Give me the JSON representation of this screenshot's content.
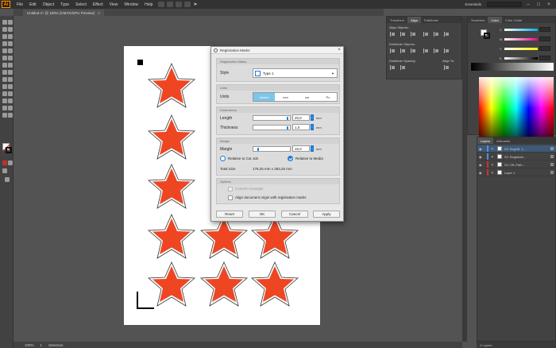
{
  "app": {
    "logo": "Ai",
    "menu": [
      "File",
      "Edit",
      "Object",
      "Type",
      "Select",
      "Effect",
      "View",
      "Window",
      "Help"
    ],
    "workspace": "Essentials",
    "search_placeholder": "Search Adobe Stock"
  },
  "document": {
    "tab_title": "Untitled-1* @ 100% (CMYK/GPU Preview)",
    "close": "×"
  },
  "status": {
    "zoom": "100%",
    "page": "1",
    "mode": "Selection"
  },
  "dialog": {
    "title": "Registration Marks",
    "close": "×",
    "sections": {
      "registration": "Registration Marks",
      "units": "Units",
      "dimensions": "Dimensions",
      "margin": "Margin",
      "options": "Options"
    },
    "style_label": "Style",
    "style_value": "Type 1",
    "units_label": "Units",
    "units_options": [
      "Inches",
      "mm",
      "cm",
      "Px"
    ],
    "units_selected": "Inches",
    "length_label": "Length",
    "length_value": "20,0",
    "length_unit": "mm",
    "thickness_label": "Thickness",
    "thickness_value": "1,0",
    "thickness_unit": "mm",
    "margin_label": "Margin",
    "margin_value": "15,0",
    "margin_unit": "mm",
    "relative_cut_label": "Relative to Cut Job",
    "relative_media_label": "Relative to Media",
    "total_size_label": "Total Size",
    "total_size_value": "178,25 mm x 283,25 mm",
    "convert_rect_label": "Convert rectangle",
    "align_origin_label": "Align document origin with registration marks",
    "buttons": {
      "reset": "Reset",
      "ok": "OK",
      "cancel": "Cancel",
      "apply": "Apply"
    }
  },
  "align_panel": {
    "tabs": [
      "Transform",
      "Align",
      "Pathfinder"
    ],
    "active_tab": "Align",
    "align_objects": "Align Objects:",
    "distribute_objects": "Distribute Objects:",
    "distribute_spacing": "Distribute Spacing:",
    "align_to": "Align To:"
  },
  "color_panel": {
    "tabs": [
      "Swatches",
      "Color",
      "Color Guide"
    ],
    "active_tab": "Color",
    "channels": [
      "C",
      "M",
      "Y",
      "K"
    ]
  },
  "layers_panel": {
    "tabs": [
      "Layers",
      "Artboards"
    ],
    "active_tab": "Layers",
    "rows": [
      {
        "name": "SC RegOff. 1...",
        "color": "#4e8fe0",
        "selected": true
      },
      {
        "name": "SC Registrati...",
        "color": "#4e8fe0",
        "selected": false
      },
      {
        "name": "SC Off.-Path...",
        "color": "#d03030",
        "selected": false
      },
      {
        "name": "Layer 1",
        "color": "#d03030",
        "selected": false
      }
    ],
    "footer": "4 Layers"
  },
  "colors": {
    "star_fill": "#ee4623",
    "accent": "#1f7ad6"
  }
}
